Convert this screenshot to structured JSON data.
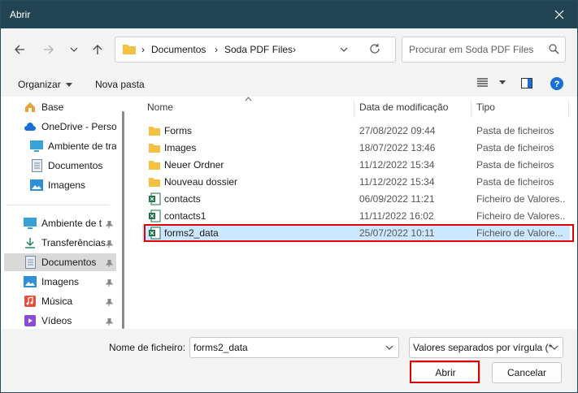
{
  "window": {
    "title": "Abrir"
  },
  "nav": {
    "breadcrumb": [
      "Documentos",
      "Soda PDF Files"
    ],
    "search_placeholder": "Procurar em Soda PDF Files"
  },
  "toolbar": {
    "organize": "Organizar",
    "new_folder": "Nova pasta"
  },
  "sidebar": {
    "items": [
      {
        "label": "Base",
        "icon": "home-icon"
      },
      {
        "label": "OneDrive - Perso",
        "icon": "cloud-icon"
      },
      {
        "label": "Ambiente de tra",
        "icon": "desktop-icon"
      },
      {
        "label": "Documentos",
        "icon": "document-icon"
      },
      {
        "label": "Imagens",
        "icon": "image-icon"
      },
      {
        "label": "Ambiente de t",
        "icon": "desktop-icon"
      },
      {
        "label": "Transferências",
        "icon": "download-icon"
      },
      {
        "label": "Documentos",
        "icon": "document-icon",
        "selected": true
      },
      {
        "label": "Imagens",
        "icon": "image-icon"
      },
      {
        "label": "Música",
        "icon": "music-icon"
      },
      {
        "label": "Vídeos",
        "icon": "video-icon"
      }
    ]
  },
  "columns": {
    "name": "Nome",
    "date": "Data de modificação",
    "type": "Tipo"
  },
  "files": [
    {
      "name": "Forms",
      "date": "27/08/2022 09:44",
      "type": "Pasta de ficheiros",
      "kind": "folder"
    },
    {
      "name": "Images",
      "date": "18/07/2022 13:46",
      "type": "Pasta de ficheiros",
      "kind": "folder"
    },
    {
      "name": "Neuer Ordner",
      "date": "11/12/2022 15:34",
      "type": "Pasta de ficheiros",
      "kind": "folder"
    },
    {
      "name": "Nouveau dossier",
      "date": "11/12/2022 15:34",
      "type": "Pasta de ficheiros",
      "kind": "folder"
    },
    {
      "name": "contacts",
      "date": "06/09/2022 11:21",
      "type": "Ficheiro de Valores...",
      "kind": "csv"
    },
    {
      "name": "contacts1",
      "date": "11/11/2022 16:02",
      "type": "Ficheiro de Valores...",
      "kind": "csv"
    },
    {
      "name": "forms2_data",
      "date": "25/07/2022 10:11",
      "type": "Ficheiro de Valore...",
      "kind": "csv",
      "selected": true
    }
  ],
  "bottom": {
    "filename_label": "Nome de ficheiro:",
    "filename_value": "forms2_data",
    "filetype": "Valores separados por vírgula (*",
    "open": "Abrir",
    "cancel": "Cancelar"
  },
  "colors": {
    "titlebar": "#234453",
    "highlight": "#e00000",
    "selection": "#cce8ff",
    "folder": "#f4c142",
    "excel": "#1e7145",
    "help": "#1a6fd6"
  }
}
